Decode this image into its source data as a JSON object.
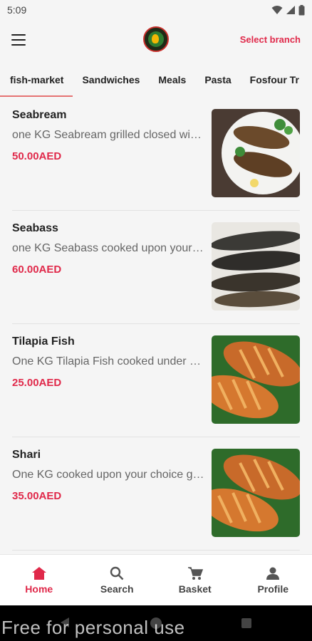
{
  "status_bar": {
    "time": "5:09"
  },
  "header": {
    "select_branch_label": "Select branch"
  },
  "tabs": [
    {
      "label": "fish-market",
      "active": true
    },
    {
      "label": "Sandwiches",
      "active": false
    },
    {
      "label": "Meals",
      "active": false
    },
    {
      "label": "Pasta",
      "active": false
    },
    {
      "label": "Fosfour Tr",
      "active": false
    }
  ],
  "items": [
    {
      "name": "Seabream",
      "description": "one KG Seabream grilled closed with...",
      "price": "50.00AED"
    },
    {
      "name": "Seabass",
      "description": "one KG Seabass cooked upon your choice",
      "price": "60.00AED"
    },
    {
      "name": "Tilapia Fish",
      "description": "One KG Tilapia Fish cooked under your",
      "price": "25.00AED"
    },
    {
      "name": "Shari",
      "description": "One KG cooked upon your choice grilled",
      "price": "35.00AED"
    }
  ],
  "bottom_nav": [
    {
      "label": "Home",
      "icon": "home-icon",
      "active": true
    },
    {
      "label": "Search",
      "icon": "search-icon",
      "active": false
    },
    {
      "label": "Basket",
      "icon": "cart-icon",
      "active": false
    },
    {
      "label": "Profile",
      "icon": "person-icon",
      "active": false
    }
  ],
  "watermark": "Free for personal use",
  "colors": {
    "accent": "#e0294a",
    "tab_indicator": "#e57373",
    "background": "#f5f5f5"
  }
}
